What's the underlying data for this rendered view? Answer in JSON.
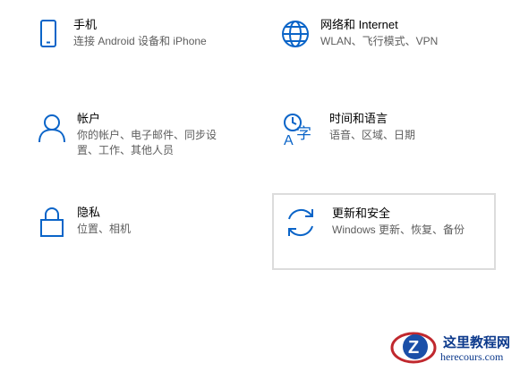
{
  "settings_tiles": [
    {
      "title": "手机",
      "desc": "连接 Android 设备和 iPhone",
      "icon": "phone-icon"
    },
    {
      "title": "网络和 Internet",
      "desc": "WLAN、飞行模式、VPN",
      "icon": "globe-icon"
    },
    {
      "title": "帐户",
      "desc": "你的帐户、电子邮件、同步设置、工作、其他人员",
      "icon": "person-icon"
    },
    {
      "title": "时间和语言",
      "desc": "语音、区域、日期",
      "icon": "time-language-icon"
    },
    {
      "title": "隐私",
      "desc": "位置、相机",
      "icon": "lock-icon"
    },
    {
      "title": "更新和安全",
      "desc": "Windows 更新、恢复、备份",
      "icon": "sync-icon"
    }
  ],
  "watermark": {
    "title": "这里教程网",
    "url": "herecours.com",
    "logo": "z-logo"
  },
  "colors": {
    "accent": "#0a64c8",
    "hover_border": "#dcdcdc",
    "desc_text": "#5d5d5d"
  }
}
